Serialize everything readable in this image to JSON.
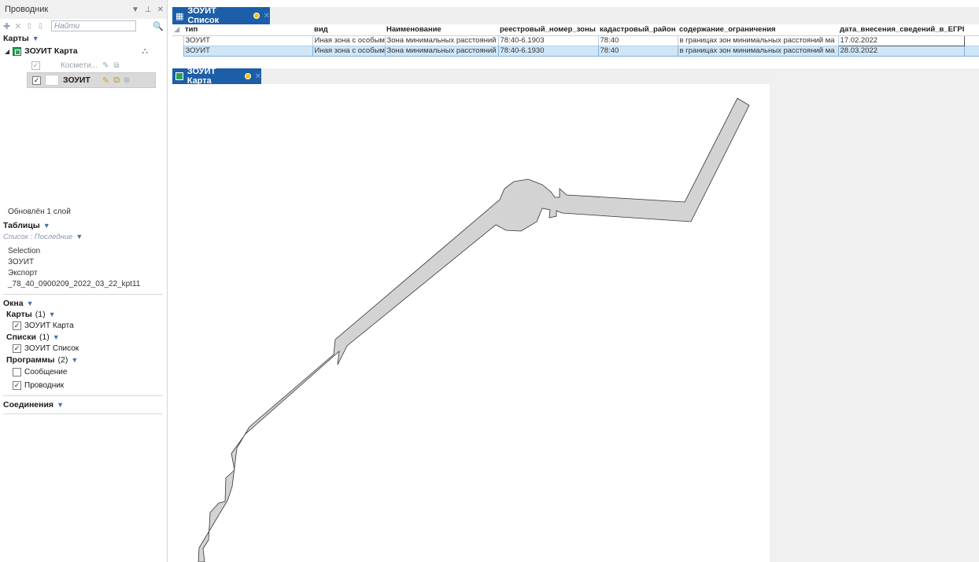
{
  "explorer": {
    "title": "Проводник",
    "ctl_pin": "▼ ⊥ ✕",
    "search_placeholder": "Найти",
    "maps_header": "Карты",
    "map_name": "ЗОУИТ Карта",
    "layer_cosmetic": "Космети...",
    "layer_zouit": "ЗОУИТ",
    "status": "Обновлён 1 слой",
    "tables_header": "Таблицы",
    "list_filter": "Список : Последние",
    "tables": [
      "Selection",
      "ЗОУИТ",
      "Экспорт",
      "_78_40_0900209_2022_03_22_kpt11"
    ],
    "windows_header": "Окна",
    "maps_group": "Карты",
    "maps_count": "(1)",
    "maps_window": "ЗОУИТ Карта",
    "lists_group": "Списки",
    "lists_count": "(1)",
    "lists_window": "ЗОУИТ Список",
    "programs_group": "Программы",
    "programs_count": "(2)",
    "program_1": "Сообщение",
    "program_2": "Проводник",
    "connections_header": "Соединения"
  },
  "list_window": {
    "tab_title": "ЗОУИТ Список",
    "columns": [
      "тип",
      "вид",
      "Наименование",
      "реестровый_номер_зоны",
      "кадастровый_район",
      "содержание_ограничения",
      "дата_внесения_сведений_в_ЕГРН"
    ],
    "rows": [
      [
        "ЗОУИТ",
        "Иная зона с особыми",
        "Зона минимальных расстояний",
        "78:40-6.1903",
        "78:40",
        "в границах зон минимальных расстояний ма",
        "17.02.2022"
      ],
      [
        "ЗОУИТ",
        "Иная зона с особыми",
        "Зона минимальных расстояний",
        "78:40-6.1930",
        "78:40",
        "в границах зон минимальных расстояний ма",
        "28.03.2022"
      ]
    ]
  },
  "map_window": {
    "tab_title": "ЗОУИТ Карта",
    "polygon_fill": "#d3d3d3"
  },
  "colors": {
    "tab_active": "#1c5ea8",
    "row_selected": "#cfe6f7"
  }
}
